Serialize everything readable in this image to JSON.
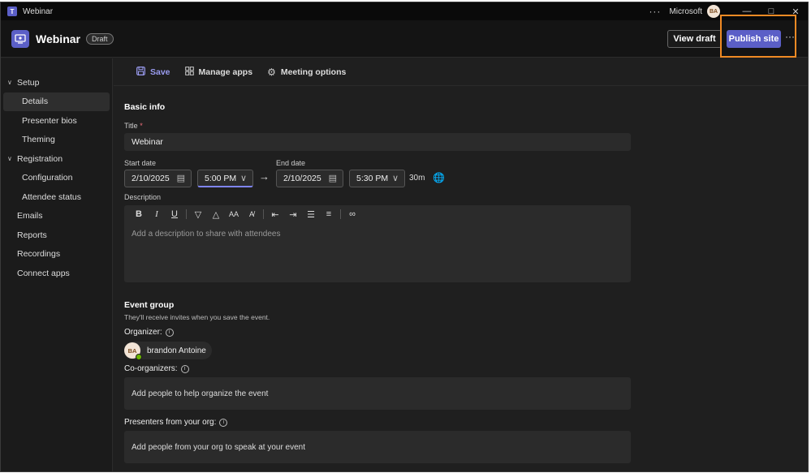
{
  "window": {
    "title": "Webinar",
    "org": "Microsoft",
    "avatar_initials": "BA",
    "menu_dots": "···",
    "minimize": "—",
    "maximize": "□",
    "close": "✕"
  },
  "header": {
    "title": "Webinar",
    "badge": "Draft",
    "view_draft_label": "View draft",
    "publish_label": "Publish site",
    "more_label": "···"
  },
  "sidebar": {
    "items": [
      {
        "label": "Setup",
        "kind": "group"
      },
      {
        "label": "Details",
        "kind": "sub",
        "active": true
      },
      {
        "label": "Presenter bios",
        "kind": "sub"
      },
      {
        "label": "Theming",
        "kind": "sub"
      },
      {
        "label": "Registration",
        "kind": "group"
      },
      {
        "label": "Configuration",
        "kind": "sub"
      },
      {
        "label": "Attendee status",
        "kind": "sub"
      },
      {
        "label": "Emails",
        "kind": "top"
      },
      {
        "label": "Reports",
        "kind": "top"
      },
      {
        "label": "Recordings",
        "kind": "top"
      },
      {
        "label": "Connect apps",
        "kind": "top"
      }
    ]
  },
  "toolbar": {
    "save_label": "Save",
    "manage_apps_label": "Manage apps",
    "meeting_options_label": "Meeting options"
  },
  "basic_info": {
    "section_title": "Basic info",
    "title_label": "Title",
    "title_required_mark": "*",
    "title_value": "Webinar",
    "start_date_label": "Start date",
    "start_date": "2/10/2025",
    "start_time": "5:00 PM",
    "end_date_label": "End date",
    "end_date": "2/10/2025",
    "end_time": "5:30 PM",
    "duration": "30m",
    "description_label": "Description",
    "description_placeholder": "Add a description to share with attendees"
  },
  "event_group": {
    "section_title": "Event group",
    "subtitle": "They'll receive invites when you save the event.",
    "organizer_label": "Organizer:",
    "organizer_initials": "BA",
    "organizer_name": "brandon Antoine",
    "coorganizers_label": "Co-organizers:",
    "coorganizers_placeholder": "Add people to help organize the event",
    "presenters_label": "Presenters from your org:",
    "presenters_placeholder": "Add people from your org to speak at your event"
  },
  "colors": {
    "accent": "#5b5fc7",
    "highlight": "#f08a24",
    "presence": "#6bb700"
  }
}
